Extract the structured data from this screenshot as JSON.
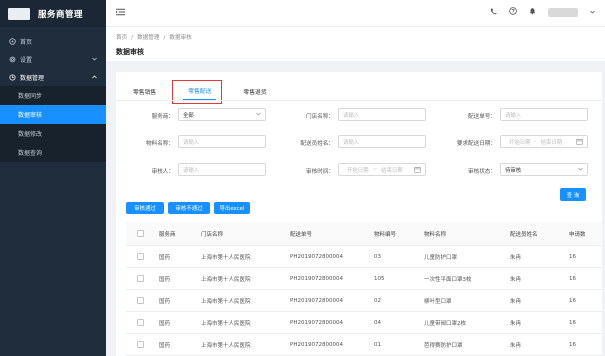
{
  "app": {
    "title": "服务商管理"
  },
  "sidebar": {
    "items": [
      {
        "label": "首页",
        "icon": "home-icon"
      },
      {
        "label": "设置",
        "icon": "settings-icon"
      },
      {
        "label": "数据管理",
        "icon": "data-icon"
      }
    ],
    "sub_items": [
      "数据同步",
      "数据审核",
      "数据修改",
      "数据查询"
    ],
    "active_sub": "数据审核"
  },
  "breadcrumb": {
    "items": [
      "首页",
      "数据管理",
      "数据审核"
    ]
  },
  "page": {
    "title": "数据审核"
  },
  "tabs": [
    "零售销售",
    "零售配送",
    "零售退货"
  ],
  "active_tab": "零售配送",
  "filters": {
    "provider": {
      "label": "服务商：",
      "value": "全部"
    },
    "store": {
      "label": "门店名称：",
      "placeholder": "请输入"
    },
    "delivery_no": {
      "label": "配送单号：",
      "placeholder": "请输入"
    },
    "material": {
      "label": "物料名称：",
      "placeholder": "请输入"
    },
    "delivery_person": {
      "label": "配送员姓名：",
      "placeholder": "请输入"
    },
    "req_date": {
      "label": "要求配送日期：",
      "start": "开始日期",
      "sep": "-",
      "end": "结束日期"
    },
    "reviewer": {
      "label": "审核人：",
      "placeholder": "请输入"
    },
    "review_time": {
      "label": "审核时间：",
      "start": "开始日期",
      "sep": "~",
      "end": "结束日期"
    },
    "review_status": {
      "label": "审核状态：",
      "value": "待审核"
    }
  },
  "buttons": {
    "search": "查 询",
    "approve": "审核通过",
    "reject": "审核不通过",
    "export": "导出excel"
  },
  "table": {
    "headers": [
      "服务商",
      "门店名称",
      "配送单号",
      "物料编号",
      "物料名称",
      "配送员姓名",
      "申请数"
    ],
    "rows": [
      [
        "国药",
        "上海市第十人民医院",
        "PH2019072800004",
        "03",
        "儿童防护口罩",
        "朱冉",
        "16"
      ],
      [
        "国药",
        "上海市第十人民医院",
        "PH2019072800004",
        "105",
        "一次性平面口罩3枚",
        "朱冉",
        "16"
      ],
      [
        "国药",
        "上海市第十人民医院",
        "PH2019072800004",
        "02",
        "柳叶型口罩",
        "朱冉",
        "16"
      ],
      [
        "国药",
        "上海市第十人民医院",
        "PH2019072800004",
        "04",
        "儿童带阀口罩2枚",
        "朱冉",
        "16"
      ],
      [
        "国药",
        "上海市第十人民医院",
        "PH2019072800004",
        "01",
        "芭得赛防护口罩",
        "朱冉",
        "16"
      ]
    ]
  },
  "colors": {
    "sidebar_bg": "#1f2d3d",
    "accent": "#1890ff",
    "highlight": "#e53935"
  }
}
